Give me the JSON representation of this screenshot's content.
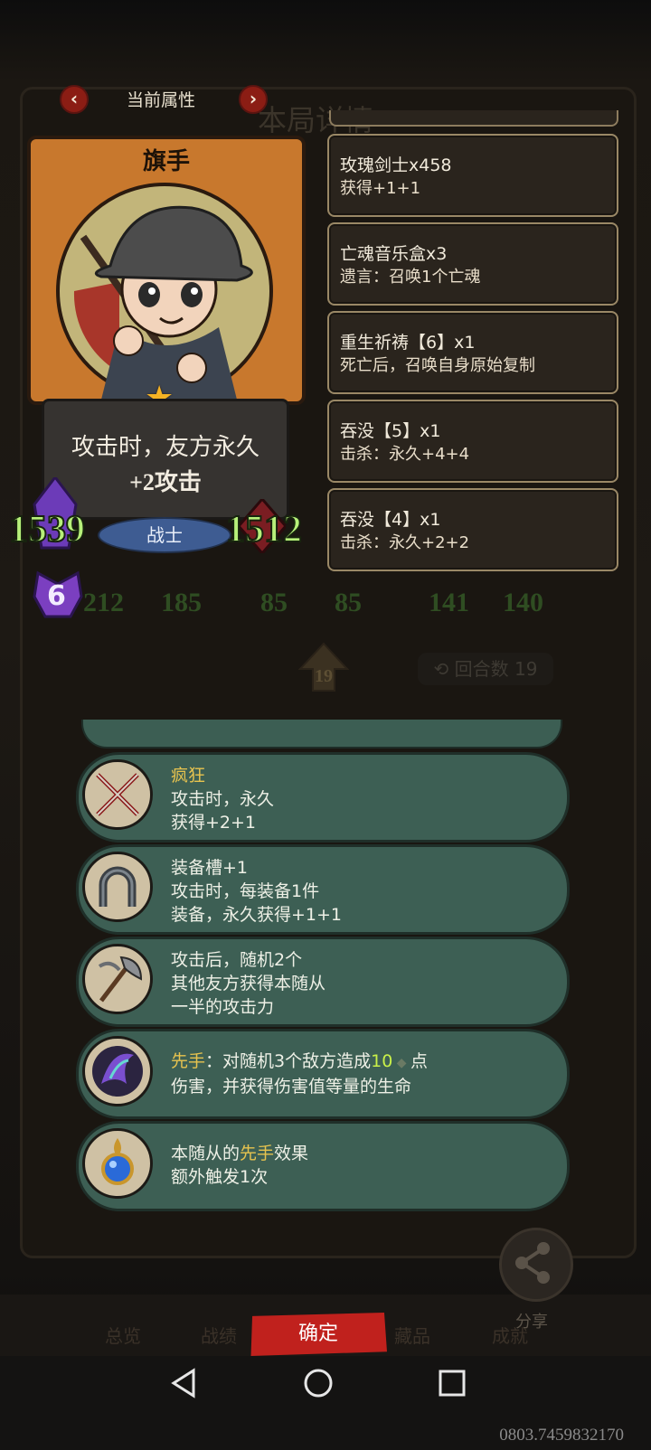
{
  "header": {
    "title": "当前属性",
    "prev_icon": "‹",
    "next_icon": "›"
  },
  "background": {
    "title": "本局详情",
    "stats": [
      "212",
      "185",
      "85",
      "85",
      "141",
      "140"
    ],
    "turn_value": "19",
    "round_label": "回合数",
    "round_value": "19"
  },
  "hero": {
    "name": "旗手",
    "description_line1": "攻击时，友方永久",
    "description_line2": "+2攻击",
    "attack": "1539",
    "health": "1512",
    "class": "战士",
    "tier": "6"
  },
  "records": [
    {
      "name": "玫瑰剑士x458",
      "effect": "获得+1+1"
    },
    {
      "name": "亡魂音乐盒x3",
      "effect": "遗言：召唤1个亡魂"
    },
    {
      "name": "重生祈祷【6】x1",
      "effect": "死亡后，召唤自身原始复制"
    },
    {
      "name": "吞没【5】x1",
      "effect": "击杀：永久+4+4"
    },
    {
      "name": "吞没【4】x1",
      "effect": "击杀：永久+2+2"
    }
  ],
  "abilities": [
    {
      "icon": "crossed-swords-icon",
      "title": "疯狂",
      "lines": [
        "攻击时，永久",
        "获得+2+1"
      ]
    },
    {
      "icon": "horseshoe-icon",
      "title": "装备槽+1",
      "lines": [
        "攻击时，每装备1件",
        "装备，永久获得+1+1"
      ]
    },
    {
      "icon": "axe-icon",
      "title": "",
      "lines": [
        "攻击后，随机2个",
        "其他友方获得本随从",
        "一半的攻击力"
      ]
    },
    {
      "icon": "spirit-orb-icon",
      "keyword": "先手",
      "text1": "：对随机3个敌方造成",
      "number": "10",
      "text1_end": "点",
      "line2": "伤害，并获得伤害值等量的生命"
    },
    {
      "icon": "blue-gem-icon",
      "prefix": "本随从的",
      "keyword": "先手",
      "suffix": "效果",
      "line2": "额外触发1次"
    }
  ],
  "bottom": {
    "tabs": [
      "总览",
      "战绩",
      "藏品",
      "成就"
    ],
    "confirm": "确定",
    "share": "分享"
  },
  "debug_code": "0803.7459832170",
  "colors": {
    "accent_red": "#c0211d",
    "stat_green": "#b7f07a",
    "keyword_gold": "#e7c34f",
    "ability_bg": "#3d5f54"
  }
}
